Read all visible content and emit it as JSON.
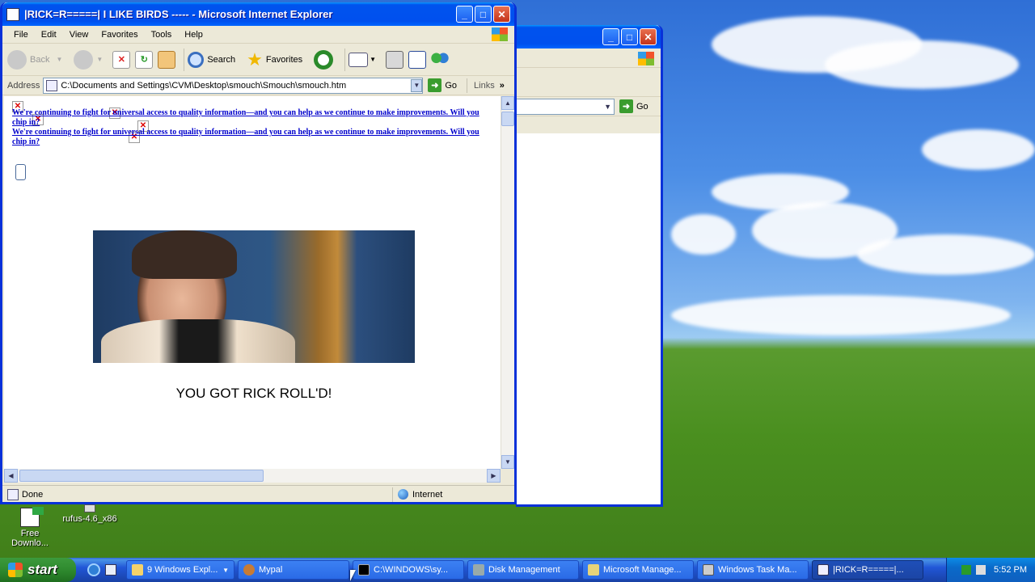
{
  "desktop": {
    "icons": [
      {
        "label": "Free Downlo...",
        "icon": "download-icon"
      },
      {
        "label": "rufus-4.6_x86",
        "icon": "usb-drive-icon"
      }
    ]
  },
  "bg_window": {
    "go_label": "Go"
  },
  "ie_window": {
    "title": "|RICK=R=====|  I LIKE BIRDS ----- - Microsoft Internet Explorer",
    "menu": [
      "File",
      "Edit",
      "View",
      "Favorites",
      "Tools",
      "Help"
    ],
    "toolbar": {
      "back": "Back",
      "search": "Search",
      "favorites": "Favorites"
    },
    "address": {
      "label": "Address",
      "value": "C:\\Documents and Settings\\CVM\\Desktop\\smouch\\Smouch\\smouch.htm",
      "go": "Go",
      "links": "Links"
    },
    "page": {
      "ad_text_1": "We're continuing to fight for universal access to quality information—and you can help as we continue to make improvements. Will you chip in?",
      "ad_text_2": "We're continuing to fight for universal access to quality information—and you can help as we continue to make improvements. Will you chip in?",
      "heading": "YOU GOT RICK ROLL'D!"
    },
    "status": {
      "left": "Done",
      "zone": "Internet"
    }
  },
  "taskbar": {
    "start": "start",
    "tasks": [
      {
        "label": "9 Windows Expl...",
        "icon": "folder-icon",
        "active": false
      },
      {
        "label": "Mypal",
        "icon": "mypal-icon",
        "active": false
      },
      {
        "label": "C:\\WINDOWS\\sy...",
        "icon": "cmd-icon",
        "active": false
      },
      {
        "label": "Disk Management",
        "icon": "disk-management-icon",
        "active": false
      },
      {
        "label": "Microsoft Manage...",
        "icon": "mmc-icon",
        "active": false
      },
      {
        "label": "Windows Task Ma...",
        "icon": "task-manager-icon",
        "active": false
      },
      {
        "label": "|RICK=R=====|...",
        "icon": "ie-icon",
        "active": true
      }
    ],
    "clock": "5:52 PM"
  },
  "colors": {
    "title_blue": "#0053ee",
    "link_blue": "#0000cc",
    "start_green": "#2f8a2f"
  }
}
